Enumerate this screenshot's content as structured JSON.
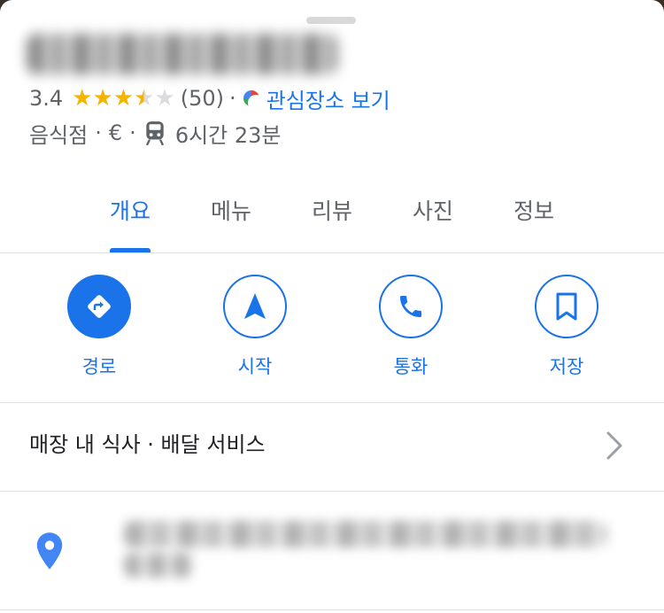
{
  "place": {
    "rating": "3.4",
    "stars": {
      "full": 3,
      "half": 1,
      "empty": 1
    },
    "review_count": "(50)",
    "separator": "·",
    "interest_link": "관심장소 보기",
    "category": "음식점",
    "price": "€",
    "transit_time": "6시간 23분"
  },
  "tabs": [
    "개요",
    "메뉴",
    "리뷰",
    "사진",
    "정보"
  ],
  "active_tab": "개요",
  "actions": {
    "directions": "경로",
    "start": "시작",
    "call": "통화",
    "save": "저장"
  },
  "services": "매장 내 식사 · 배달 서비스",
  "colors": {
    "accent": "#1a73e8",
    "star": "#f4b400",
    "text_secondary": "#5f6368"
  },
  "icons": [
    "directions-icon",
    "navigation-arrow-icon",
    "phone-icon",
    "bookmark-icon",
    "transit-icon",
    "location-pin-icon",
    "chevron-right-icon"
  ]
}
